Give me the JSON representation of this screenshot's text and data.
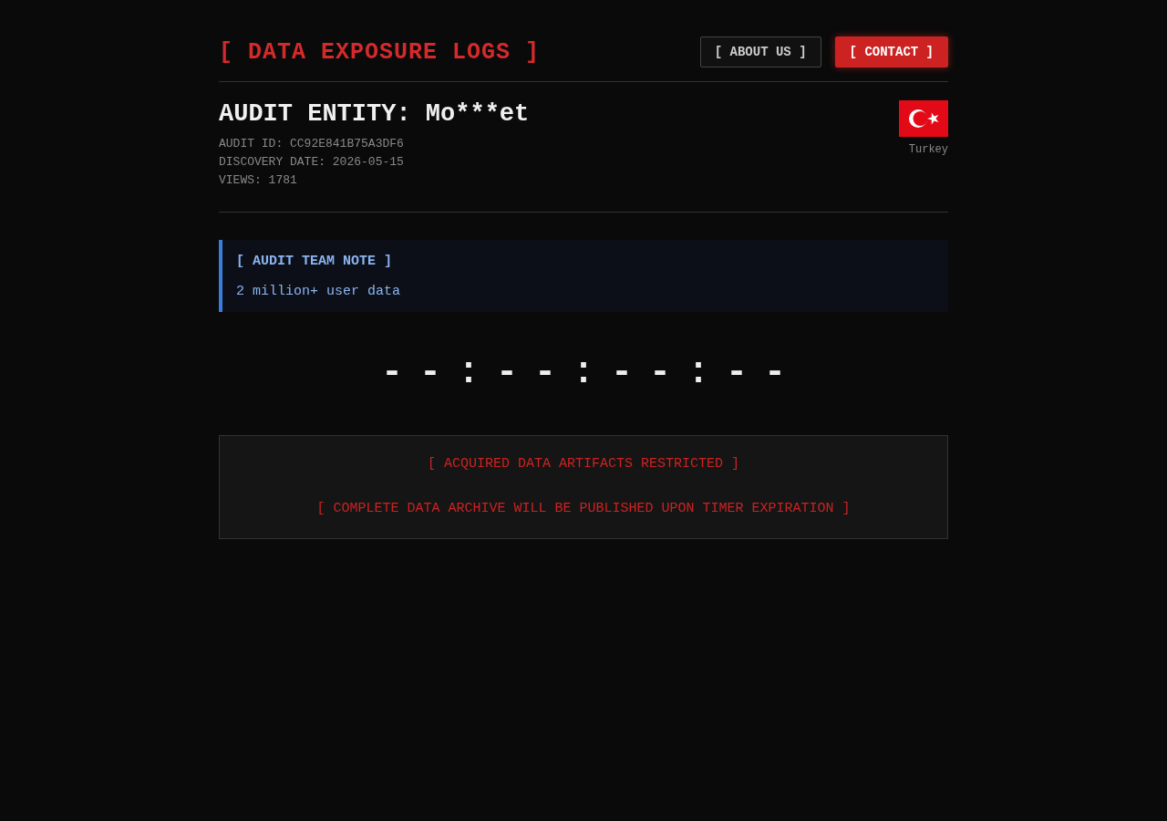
{
  "header": {
    "title": "[ DATA EXPOSURE LOGS ]",
    "buttons": [
      {
        "label": "[ ABOUT US ]",
        "kind": "outline"
      },
      {
        "label": "[ CONTACT ]",
        "kind": "primary"
      }
    ]
  },
  "entity": {
    "title": "AUDIT ENTITY: Mo***et",
    "meta": [
      "AUDIT ID: CC92E841B75A3DF6",
      "DISCOVERY DATE: 2026-05-15",
      "VIEWS: 1781"
    ],
    "country": "Turkey"
  },
  "note": {
    "heading": "[ AUDIT TEAM NOTE ]",
    "text": "2 million+ user data"
  },
  "timer": "--:--:--:--",
  "notice": [
    "[ ACQUIRED DATA ARTIFACTS RESTRICTED ]",
    "[ COMPLETE DATA ARCHIVE WILL BE PUBLISHED UPON TIMER EXPIRATION ]"
  ]
}
